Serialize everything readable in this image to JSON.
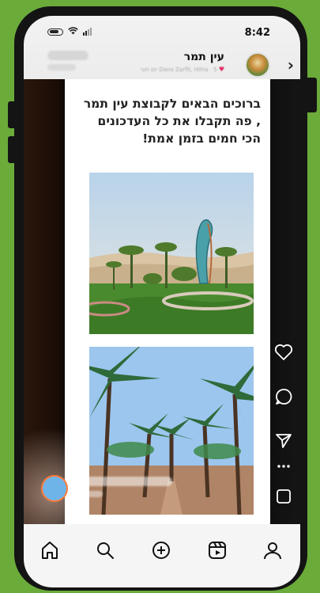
{
  "status_bar": {
    "time": "8:42"
  },
  "header": {
    "title": "עין תמר",
    "subtitle": "Dana Zarfit, Hilna · 5 יום חוגי",
    "back_icon": "chevron-right-icon",
    "avatar_icon": "group-avatar"
  },
  "post": {
    "text": "ברוכים הבאים לקבוצת עין תמר , פה תקבלו את כל העדכונים הכי חמים בזמן אמת!"
  },
  "actions": [
    {
      "name": "like",
      "icon": "heart-icon"
    },
    {
      "name": "comment",
      "icon": "comment-icon"
    },
    {
      "name": "share",
      "icon": "send-icon"
    },
    {
      "name": "more",
      "icon": "more-icon"
    },
    {
      "name": "save",
      "icon": "bookmark-icon"
    }
  ],
  "bottom_nav": [
    {
      "name": "home",
      "icon": "home-icon"
    },
    {
      "name": "search",
      "icon": "search-icon"
    },
    {
      "name": "create",
      "icon": "plus-circle-icon"
    },
    {
      "name": "reels",
      "icon": "reels-icon"
    },
    {
      "name": "profile",
      "icon": "profile-icon"
    }
  ],
  "colors": {
    "background": "#6bab3a",
    "avatar_ring": "#ff7b3a",
    "heart": "#e0245e"
  }
}
